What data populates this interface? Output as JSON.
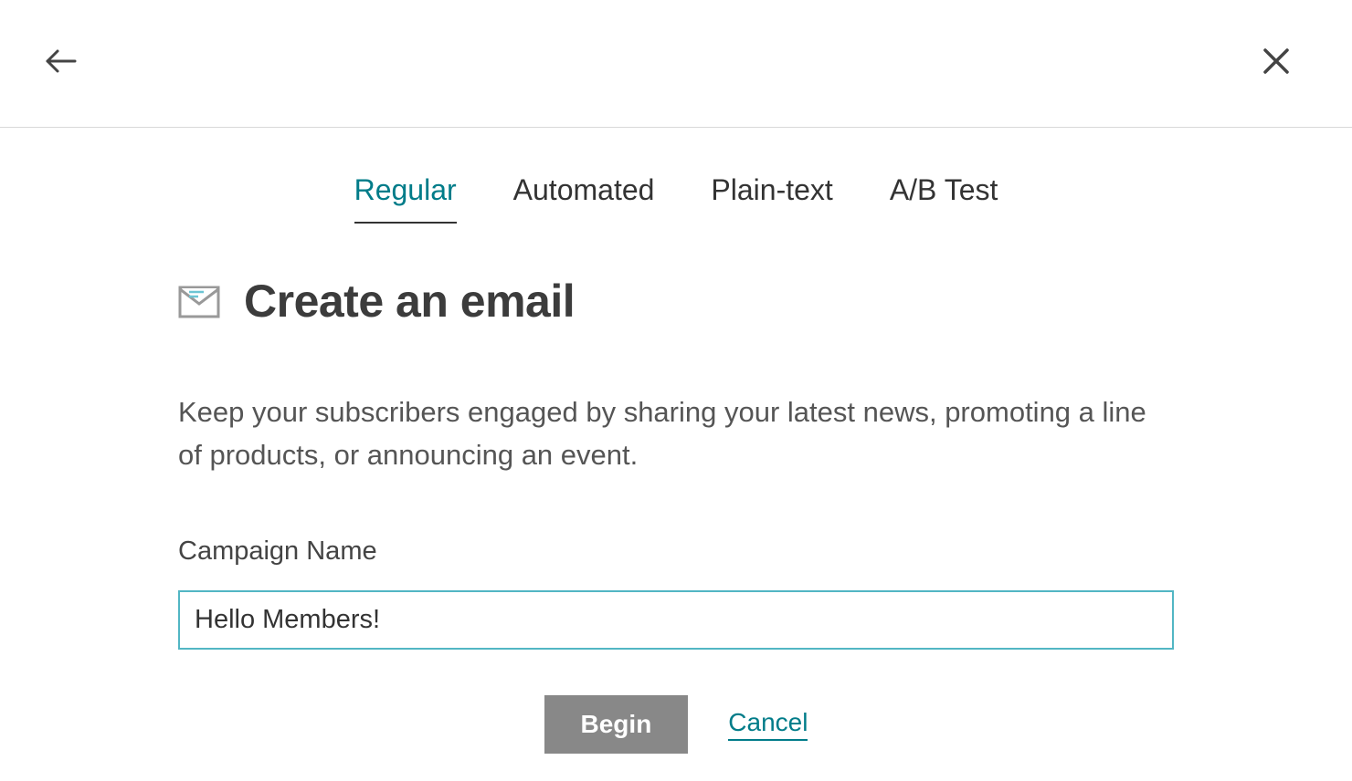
{
  "tabs": [
    {
      "label": "Regular",
      "active": true
    },
    {
      "label": "Automated",
      "active": false
    },
    {
      "label": "Plain-text",
      "active": false
    },
    {
      "label": "A/B Test",
      "active": false
    }
  ],
  "page": {
    "title": "Create an email",
    "description": "Keep your subscribers engaged by sharing your latest news, promoting a line of products, or announcing an event."
  },
  "form": {
    "campaign_name_label": "Campaign Name",
    "campaign_name_value": "Hello Members!"
  },
  "actions": {
    "begin_label": "Begin",
    "cancel_label": "Cancel"
  }
}
